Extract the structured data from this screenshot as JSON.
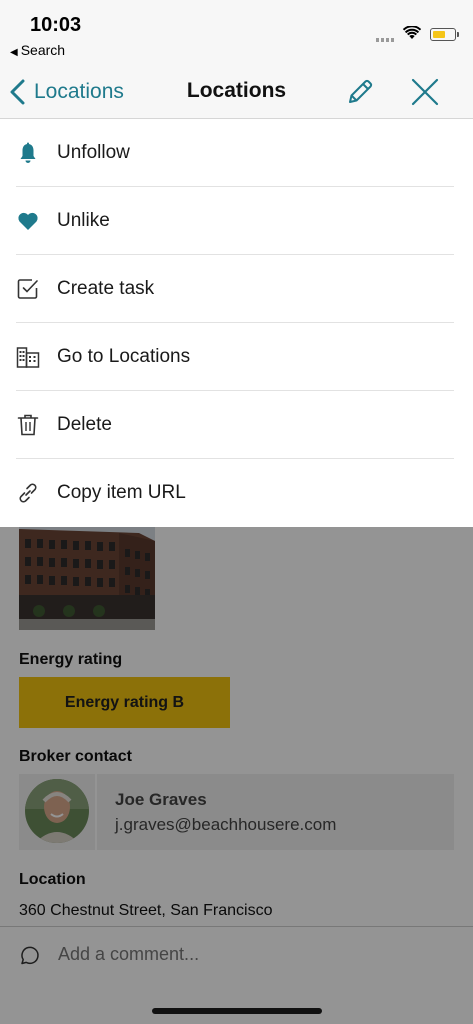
{
  "status_bar": {
    "time": "10:03",
    "back_app": "Search"
  },
  "nav": {
    "back_label": "Locations",
    "title": "Locations",
    "accent_color": "#1f7a8c"
  },
  "menu": {
    "items": [
      {
        "label": "Unfollow",
        "icon": "bell-icon"
      },
      {
        "label": "Unlike",
        "icon": "heart-icon"
      },
      {
        "label": "Create task",
        "icon": "task-checkbox-icon"
      },
      {
        "label": "Go to Locations",
        "icon": "buildings-icon"
      },
      {
        "label": "Delete",
        "icon": "trash-icon"
      },
      {
        "label": "Copy item URL",
        "icon": "link-icon"
      }
    ]
  },
  "details": {
    "energy_rating_label": "Energy rating",
    "energy_rating_value": "Energy rating B",
    "energy_badge_color": "#f2c311",
    "broker_label": "Broker contact",
    "broker_name": "Joe Graves",
    "broker_email": "j.graves@beachhousere.com",
    "location_label": "Location",
    "location_value": "360 Chestnut Street, San Francisco"
  },
  "comment": {
    "placeholder": "Add a comment..."
  }
}
